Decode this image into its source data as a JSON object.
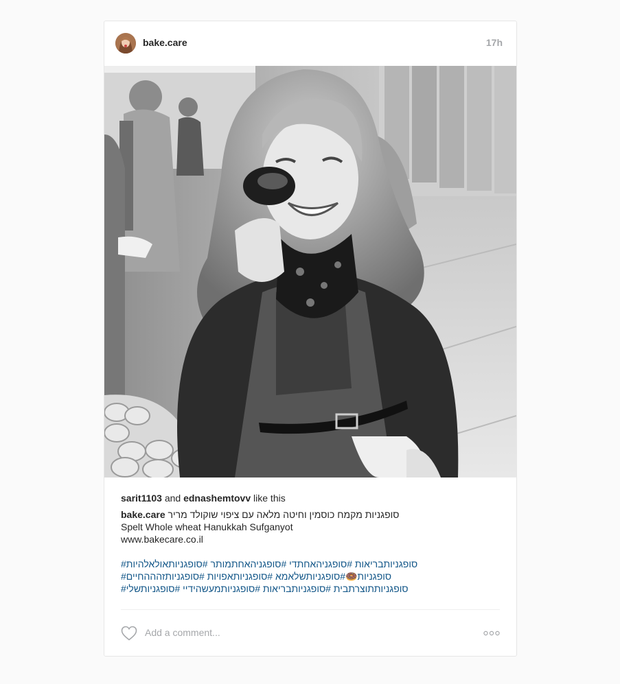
{
  "post": {
    "username": "bake.care",
    "time": "17h"
  },
  "likes": {
    "user1": "sarit1103",
    "and_text": " and ",
    "user2": "ednashemtovv",
    "suffix": " like this"
  },
  "caption": {
    "author": "bake.care",
    "line1_text": " סופגניות מקמח כוסמין וחיטה מלאה עם ציפוי שוקולד מריר",
    "line2": "Spelt Whole wheat Hanukkah Sufganyot",
    "line3": "www.bakecare.co.il"
  },
  "hashtags": {
    "line1": "#סופגניותבריאות #סופגניהאחתדי #סופגניהאחתמותר #סופגניותאולאלהיות",
    "line2": "#סופגניות🍩#סופגניותשלאמא #סופגניותאפויות #סופגניותזהההחיים",
    "line3": "#סופגניותתוצרתבית #סופגניותבריאות #סופגניותמעשהידיי #סופגניותשלי"
  },
  "comment": {
    "placeholder": "Add a comment..."
  },
  "icons": {
    "avatar": "avatar",
    "like": "heart-icon",
    "more": "more-options-icon"
  },
  "colors": {
    "hashtag": "#125688",
    "muted": "#a5a7aa",
    "text": "#262626"
  }
}
